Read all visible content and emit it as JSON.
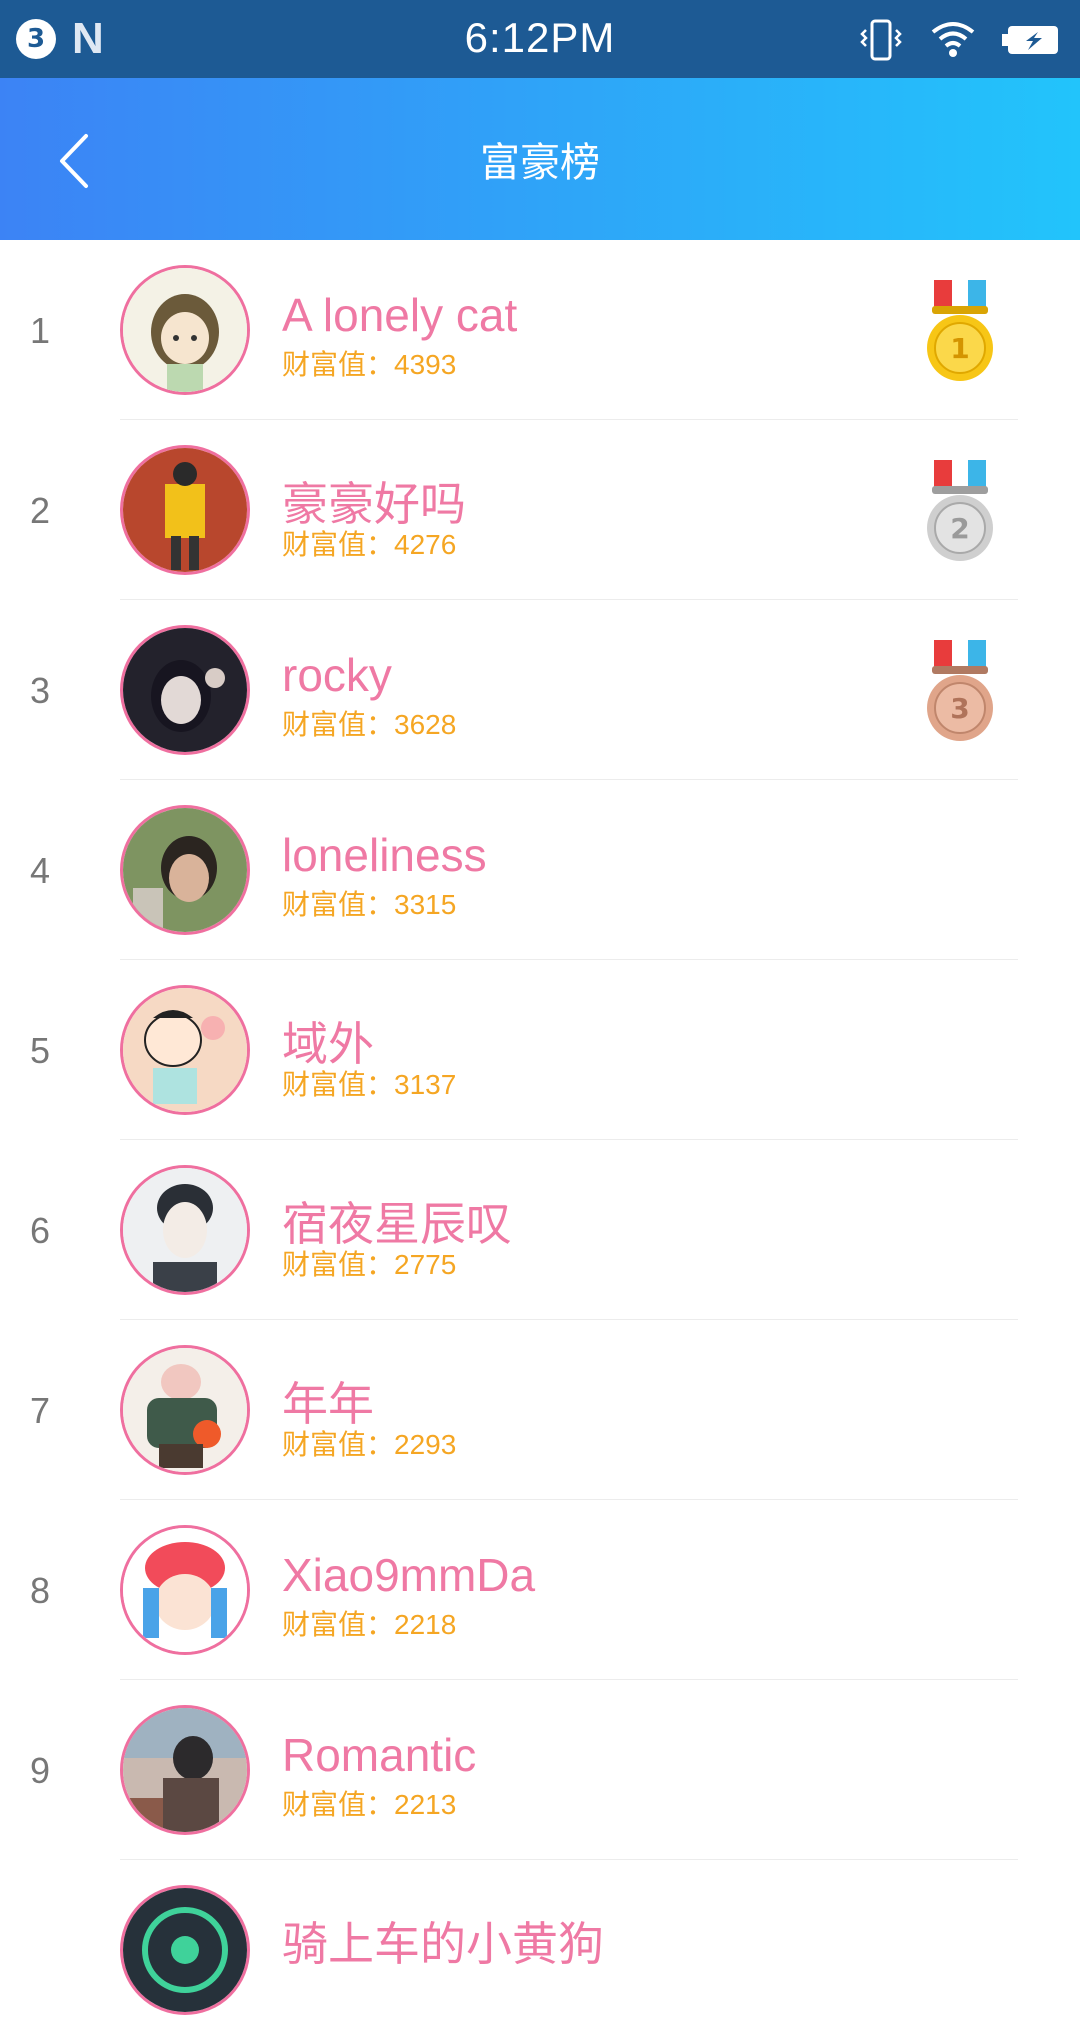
{
  "status_bar": {
    "notification_count": "3",
    "n_glyph": "N",
    "time": "6:12PM",
    "icons": [
      "vibrate-icon",
      "wifi-icon",
      "battery-charging-icon"
    ]
  },
  "header": {
    "title": "富豪榜",
    "back_icon": "chevron-left-icon",
    "gradient": [
      "#3c83f5",
      "#22c4fb"
    ]
  },
  "colors": {
    "name": "#ef79a4",
    "wealth": "#f5a623",
    "avatar_border": "#ef6f9f",
    "rank": "#777777"
  },
  "wealth_label": "财富值：",
  "entries": [
    {
      "rank": "1",
      "name": "A lonely cat",
      "wealth": "4393",
      "medal": "gold-medal-icon"
    },
    {
      "rank": "2",
      "name": "豪豪好吗",
      "wealth": "4276",
      "medal": "silver-medal-icon"
    },
    {
      "rank": "3",
      "name": "rocky",
      "wealth": "3628",
      "medal": "bronze-medal-icon"
    },
    {
      "rank": "4",
      "name": "loneliness",
      "wealth": "3315"
    },
    {
      "rank": "5",
      "name": "域外",
      "wealth": "3137"
    },
    {
      "rank": "6",
      "name": "宿夜星辰叹",
      "wealth": "2775"
    },
    {
      "rank": "7",
      "name": "年年",
      "wealth": "2293"
    },
    {
      "rank": "8",
      "name": "Xiao9mmDa",
      "wealth": "2218"
    },
    {
      "rank": "9",
      "name": "Romantic",
      "wealth": "2213"
    },
    {
      "rank": "",
      "name": "骑上车的小黄狗",
      "wealth": ""
    }
  ]
}
